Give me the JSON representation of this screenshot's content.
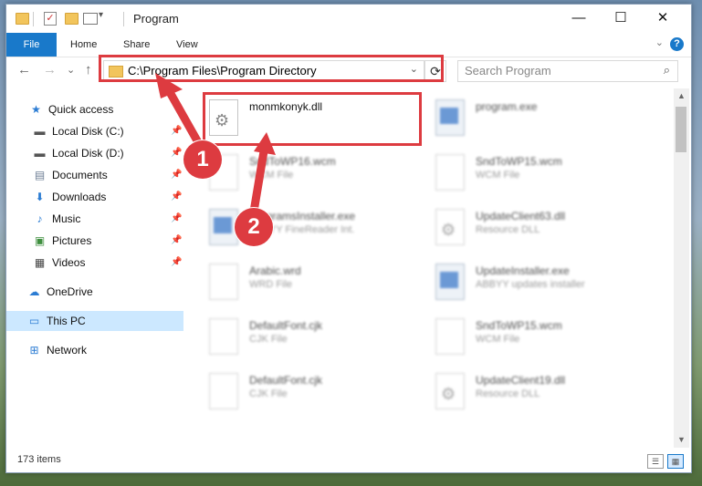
{
  "window": {
    "title": "Program",
    "minimize_glyph": "—",
    "maximize_glyph": "☐",
    "close_glyph": "✕"
  },
  "ribbon": {
    "file": "File",
    "tabs": [
      "Home",
      "Share",
      "View"
    ],
    "help_glyph": "?",
    "expand_glyph": "⌄"
  },
  "nav": {
    "back_glyph": "←",
    "forward_glyph": "→",
    "recent_glyph": "⌄",
    "up_glyph": "↑",
    "address": "C:\\Program Files\\Program Directory",
    "address_dropdown_glyph": "⌄",
    "refresh_glyph": "⟳",
    "search_placeholder": "Search Program",
    "search_glyph": "⌕"
  },
  "sidebar": {
    "pin_glyph": "📌",
    "items": [
      {
        "label": "Quick access",
        "icon": "star-icon",
        "glyph": "★",
        "color": "#2b7cd3"
      },
      {
        "label": "Local Disk (C:)",
        "icon": "drive-icon",
        "glyph": "▬",
        "color": "#555555"
      },
      {
        "label": "Local Disk (D:)",
        "icon": "drive-icon",
        "glyph": "▬",
        "color": "#555555"
      },
      {
        "label": "Documents",
        "icon": "document-icon",
        "glyph": "▤",
        "color": "#6b7c93"
      },
      {
        "label": "Downloads",
        "icon": "download-icon",
        "glyph": "⬇",
        "color": "#2b7cd3"
      },
      {
        "label": "Music",
        "icon": "music-icon",
        "glyph": "♪",
        "color": "#2b7cd3"
      },
      {
        "label": "Pictures",
        "icon": "pictures-icon",
        "glyph": "▣",
        "color": "#3f8f3f"
      },
      {
        "label": "Videos",
        "icon": "video-icon",
        "glyph": "▦",
        "color": "#444444"
      },
      {
        "label": "OneDrive",
        "icon": "cloud-icon",
        "glyph": "☁",
        "color": "#2b7cd3"
      },
      {
        "label": "This PC",
        "icon": "computer-icon",
        "glyph": "▭",
        "color": "#2b7cd3"
      },
      {
        "label": "Network",
        "icon": "network-icon",
        "glyph": "⊞",
        "color": "#2b7cd3"
      }
    ]
  },
  "files": [
    {
      "name": "monmkonyk.dll",
      "desc": "",
      "icon": "gear"
    },
    {
      "name": "program.exe",
      "desc": "",
      "icon": "app"
    },
    {
      "name": "SndToWP16.wcm",
      "desc": "WCM File",
      "icon": "doc"
    },
    {
      "name": "SndToWP15.wcm",
      "desc": "WCM File",
      "icon": "doc"
    },
    {
      "name": "ProgramsInstaller.exe",
      "desc": "ABBYY FineReader Int.",
      "icon": "app"
    },
    {
      "name": "UpdateClient63.dll",
      "desc": "Resource DLL",
      "icon": "gear"
    },
    {
      "name": "Arabic.wrd",
      "desc": "WRD File",
      "icon": "doc"
    },
    {
      "name": "UpdateInstaller.exe",
      "desc": "ABBYY updates installer",
      "icon": "app"
    },
    {
      "name": "DefaultFont.cjk",
      "desc": "CJK File",
      "icon": "doc"
    },
    {
      "name": "SndToWP15.wcm",
      "desc": "WCM File",
      "icon": "doc"
    },
    {
      "name": "DefaultFont.cjk",
      "desc": "CJK File",
      "icon": "doc"
    },
    {
      "name": "UpdateClient19.dll",
      "desc": "Resource DLL",
      "icon": "gear"
    }
  ],
  "status": {
    "count": "173 items",
    "details_glyph": "☰",
    "tiles_glyph": "▦"
  },
  "annotations": {
    "callout_1": "1",
    "callout_2": "2",
    "color": "#dd3b40"
  }
}
